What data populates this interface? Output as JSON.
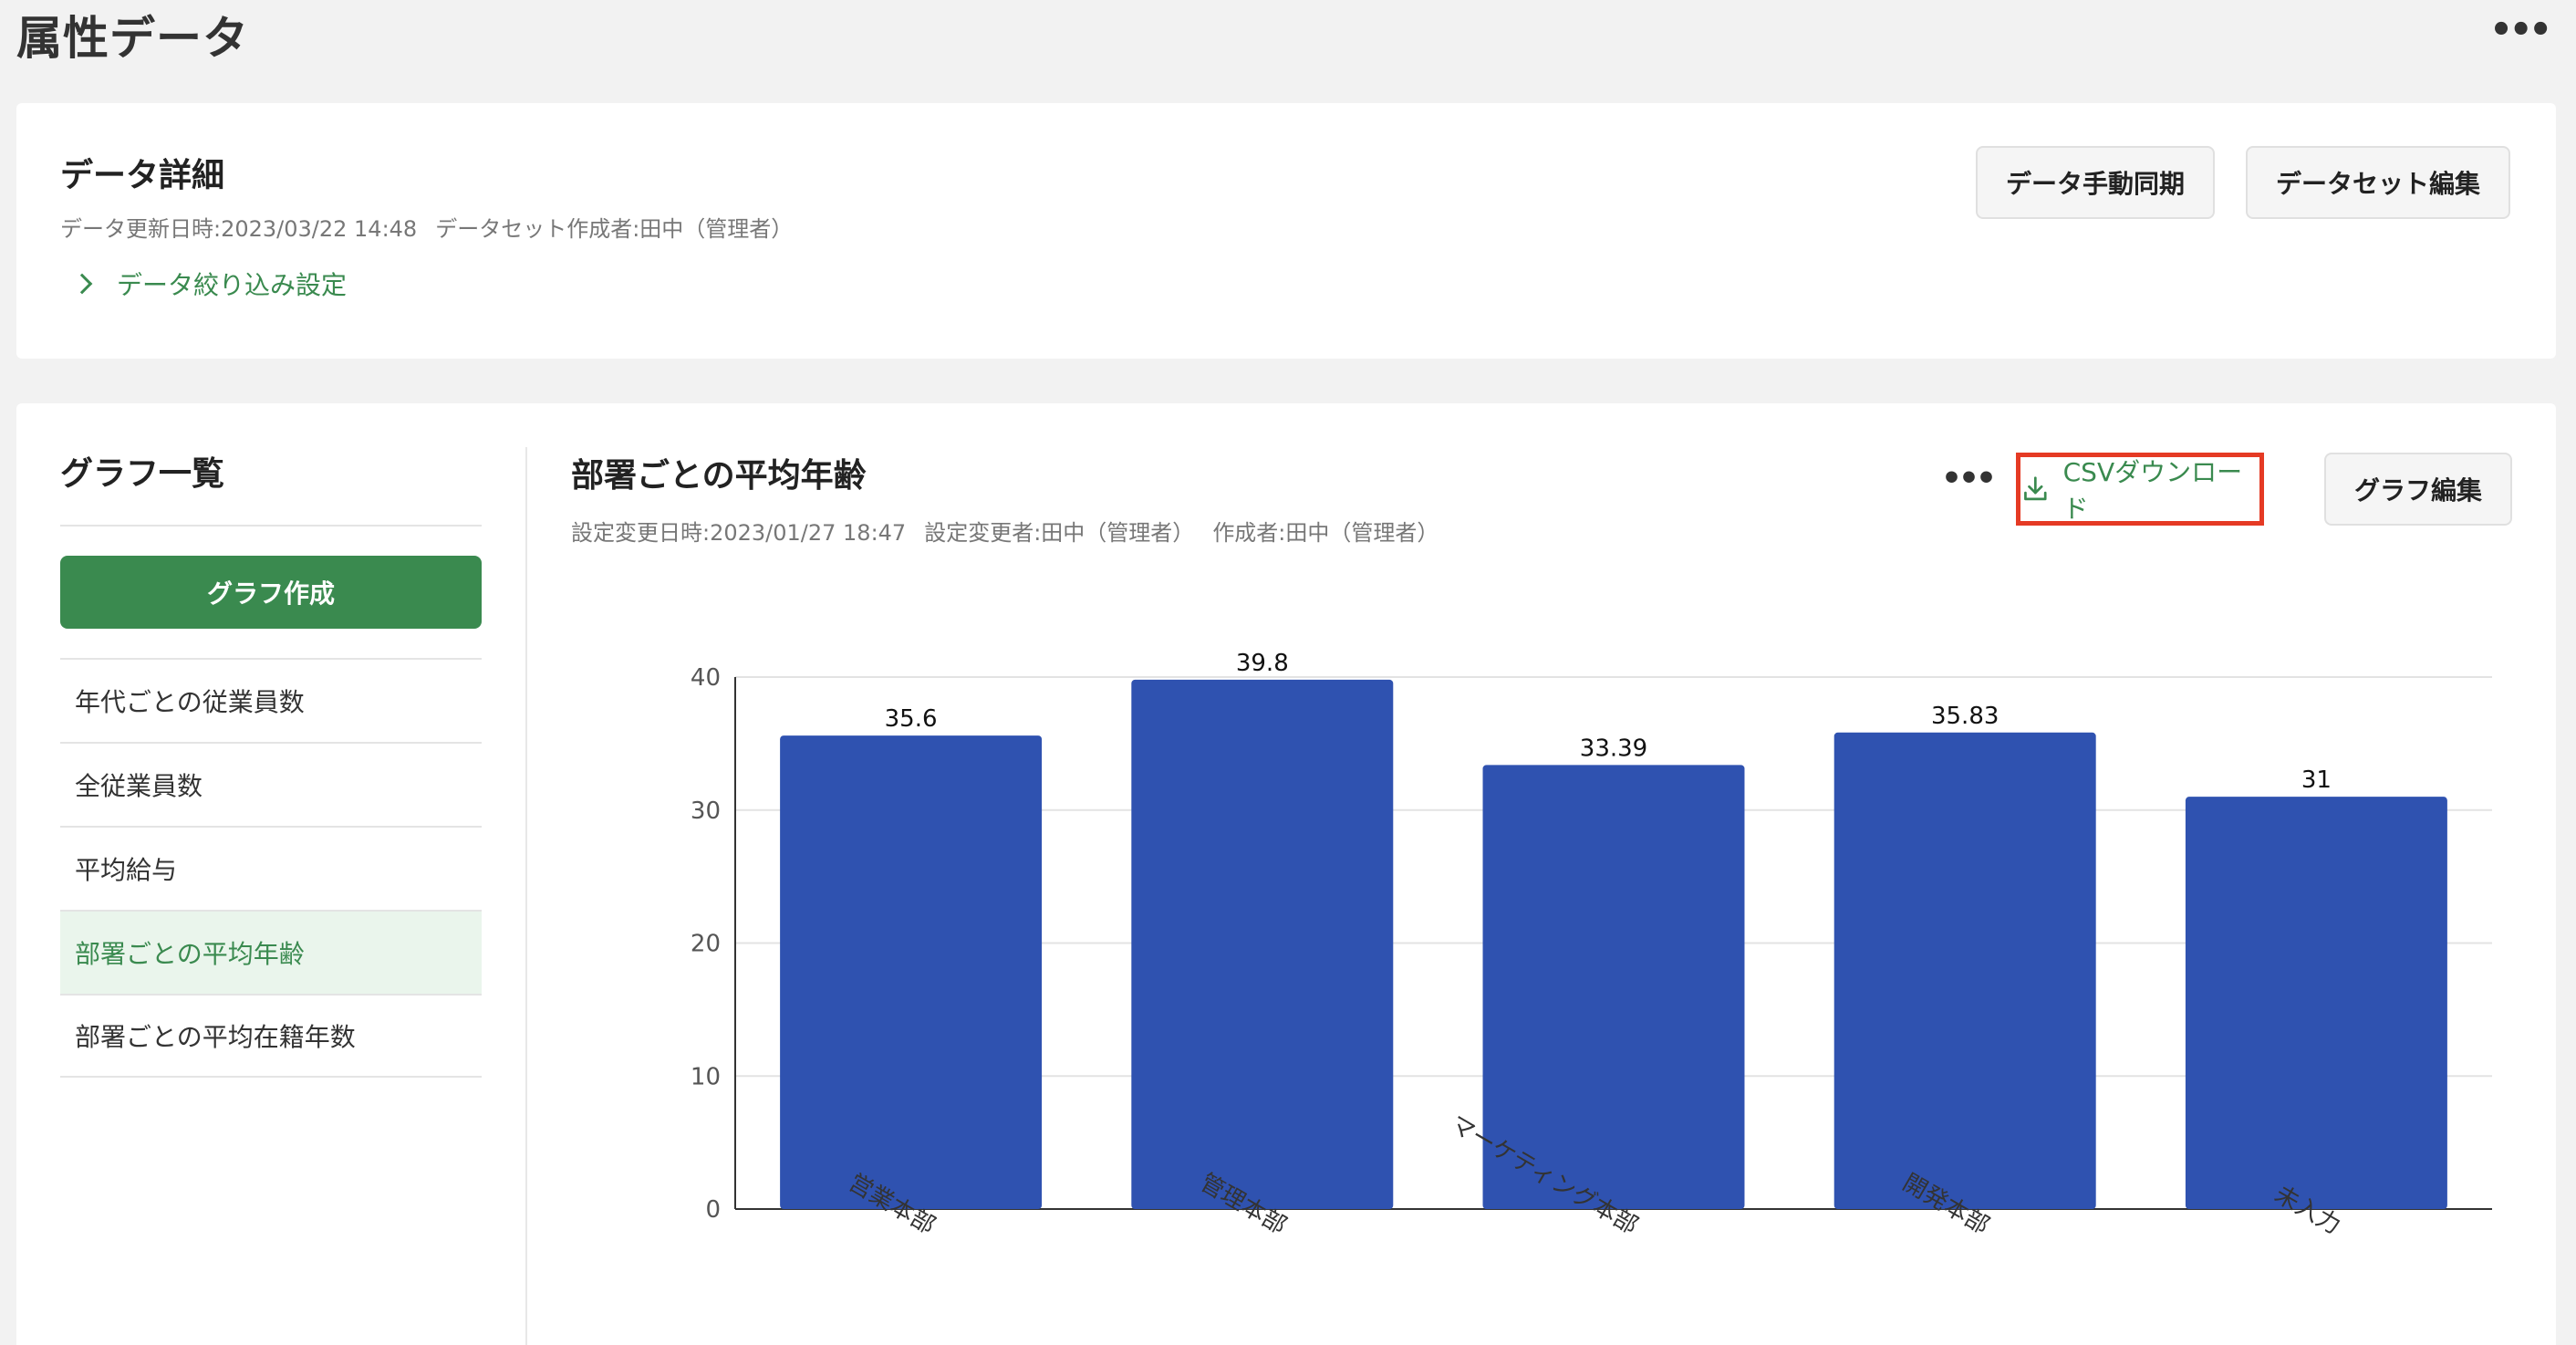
{
  "page": {
    "title": "属性データ",
    "more_label": "•••"
  },
  "detail": {
    "heading": "データ詳細",
    "updated": "データ更新日時:2023/03/22 14:48",
    "creator": "データセット作成者:田中（管理者）",
    "filter_link": "データ絞り込み設定",
    "sync_button": "データ手動同期",
    "edit_button": "データセット編集"
  },
  "sidebar": {
    "title": "グラフ一覧",
    "create_button": "グラフ作成",
    "items": [
      {
        "label": "年代ごとの従業員数"
      },
      {
        "label": "全従業員数"
      },
      {
        "label": "平均給与"
      },
      {
        "label": "部署ごとの平均年齢",
        "active": true
      },
      {
        "label": "部署ごとの平均在籍年数"
      }
    ]
  },
  "chart_panel": {
    "title": "部署ごとの平均年齢",
    "settings_changed": "設定変更日時:2023/01/27 18:47",
    "changed_by": "設定変更者:田中（管理者）",
    "created_by": "作成者:田中（管理者）",
    "more_label": "•••",
    "csv_button": "CSVダウンロード",
    "edit_button": "グラフ編集"
  },
  "colors": {
    "accent": "#3a8a4f",
    "bar": "#2f52b0",
    "highlight": "#e53a24"
  },
  "icons": {
    "download": "download-icon",
    "chevron": "chevron-right-icon",
    "more": "more-horizontal-icon"
  },
  "chart_data": {
    "type": "bar",
    "categories": [
      "営業本部",
      "管理本部",
      "マーケティング本部",
      "開発本部",
      "未入力"
    ],
    "values": [
      35.6,
      39.8,
      33.39,
      35.83,
      31
    ],
    "data_labels": [
      "35.6",
      "39.8",
      "33.39",
      "35.83",
      "31"
    ],
    "ylim": [
      0,
      40
    ],
    "yticks": [
      0,
      10,
      20,
      30,
      40
    ],
    "grid": true,
    "legend": "none",
    "title": "",
    "xlabel": "",
    "ylabel": ""
  }
}
